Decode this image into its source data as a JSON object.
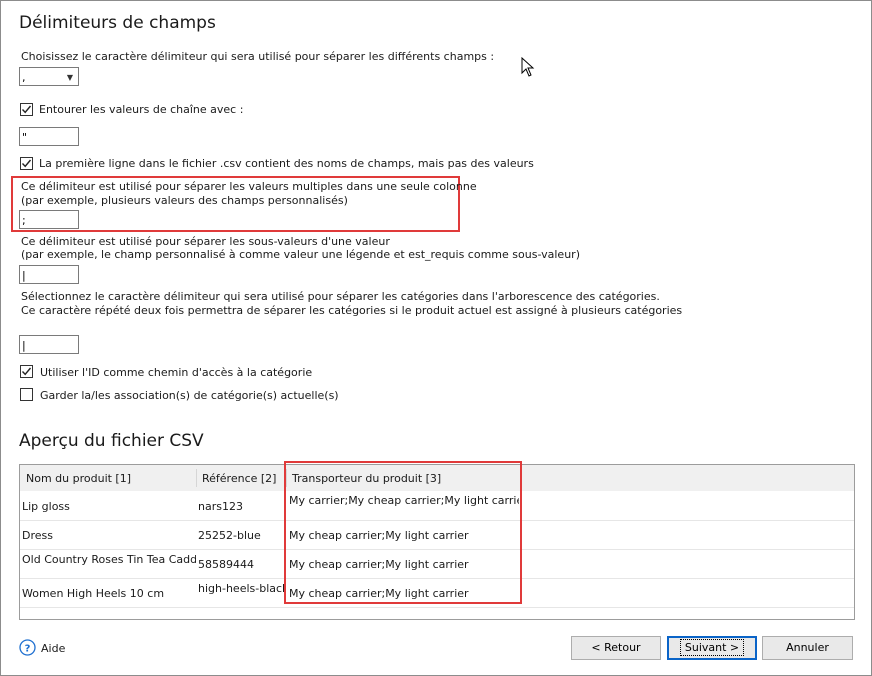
{
  "section1": {
    "title": "Délimiteurs de champs"
  },
  "field_delimiter": {
    "label": "Choisissez le caractère délimiteur qui sera utilisé pour séparer les différents champs :",
    "value": ","
  },
  "enclose": {
    "label": "Entourer les valeurs de chaîne avec :",
    "checked": true,
    "value": "\""
  },
  "first_line": {
    "label": "La première ligne dans le fichier .csv contient des noms de champs, mais pas des valeurs",
    "checked": true
  },
  "multi_value": {
    "line1": "Ce délimiteur est utilisé pour séparer les valeurs multiples dans une seule colonne",
    "line2": " (par exemple, plusieurs valeurs des champs personnalisés)",
    "value": ";"
  },
  "sub_value": {
    "line1": "Ce délimiteur est utilisé pour séparer les sous-valeurs d'une valeur",
    "line2": "(par exemple, le champ personnalisé à comme valeur une légende et est_requis comme sous-valeur)",
    "value": "|"
  },
  "category": {
    "line1": "Sélectionnez le caractère délimiteur qui sera utilisé pour séparer les catégories dans l'arborescence des catégories.",
    "line2": "Ce caractère répété deux fois permettra de séparer les catégories si le produit actuel est assigné à plusieurs catégories",
    "value": "|"
  },
  "use_id": {
    "label": "Utiliser l'ID comme chemin d'accès à la catégorie",
    "checked": true
  },
  "keep_assoc": {
    "label": "Garder la/les association(s) de catégorie(s) actuelle(s)",
    "checked": false
  },
  "section2": {
    "title": "Aperçu du fichier CSV"
  },
  "table": {
    "headers": [
      "Nom du produit [1]",
      "Référence [2]",
      "Transporteur du produit [3]"
    ],
    "rows": [
      [
        "Lip gloss",
        "nars123",
        "My carrier;My cheap carrier;My light carrier"
      ],
      [
        "Dress",
        "25252-blue",
        "My cheap carrier;My light carrier"
      ],
      [
        "Old Country Roses Tin Tea Caddy",
        "58589444",
        "My cheap carrier;My light carrier"
      ],
      [
        "Women High Heels 10 cm",
        "high-heels-black",
        "My cheap carrier;My light carrier"
      ]
    ]
  },
  "footer": {
    "help": "Aide",
    "back": "< Retour",
    "next": "Suivant >",
    "cancel": "Annuler"
  },
  "colors": {
    "highlight": "#e03a3a",
    "help_icon": "#1e6fd0"
  }
}
